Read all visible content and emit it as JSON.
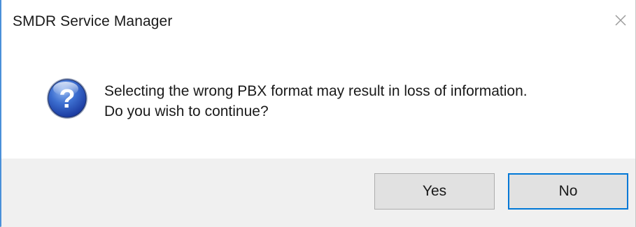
{
  "window": {
    "title": "SMDR Service Manager",
    "close_icon": "close-icon"
  },
  "message": {
    "icon": "question-icon",
    "line1": "Selecting the wrong PBX format may result in loss of information.",
    "line2": "Do you wish to continue?"
  },
  "buttons": {
    "yes_label": "Yes",
    "no_label": "No"
  },
  "colors": {
    "accent_border": "#4a90d9",
    "default_button_border": "#0078d7",
    "footer_bg": "#f0f0f0"
  }
}
